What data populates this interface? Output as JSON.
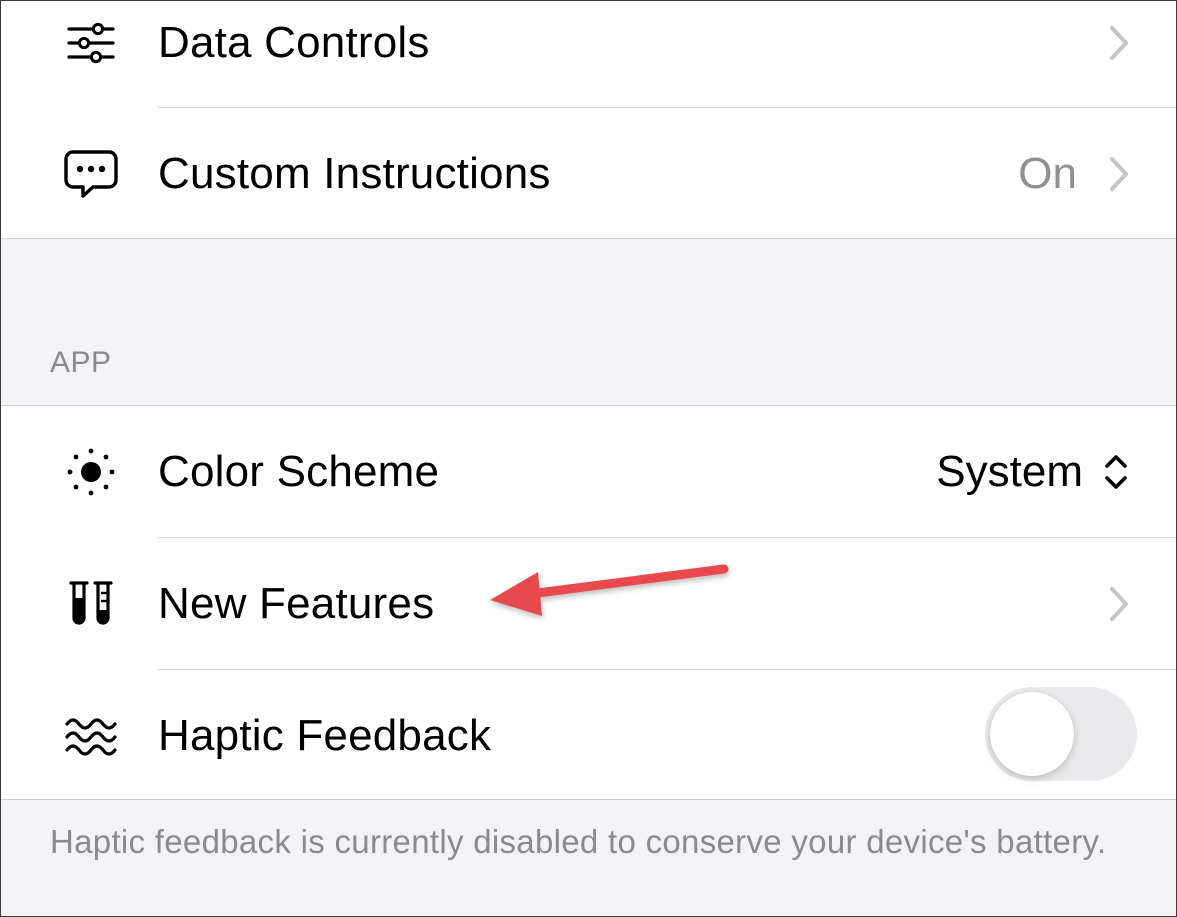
{
  "account_group": {
    "items": [
      {
        "label": "Data Controls",
        "value": "",
        "icon": "sliders-icon"
      },
      {
        "label": "Custom Instructions",
        "value": "On",
        "icon": "chat-bubble-icon"
      }
    ]
  },
  "app_section": {
    "header": "APP",
    "items": [
      {
        "label": "Color Scheme",
        "value": "System",
        "icon": "sun-icon"
      },
      {
        "label": "New Features",
        "value": "",
        "icon": "test-tubes-icon"
      },
      {
        "label": "Haptic Feedback",
        "value": "",
        "icon": "waves-icon",
        "toggle_on": false
      }
    ],
    "footnote": "Haptic feedback is currently disabled to conserve your device's battery."
  },
  "colors": {
    "background": "#f2f2f7",
    "secondary_text": "#8e8e93",
    "annotation_arrow": "#e8484d",
    "toggle_off": "#e9e9eb"
  }
}
